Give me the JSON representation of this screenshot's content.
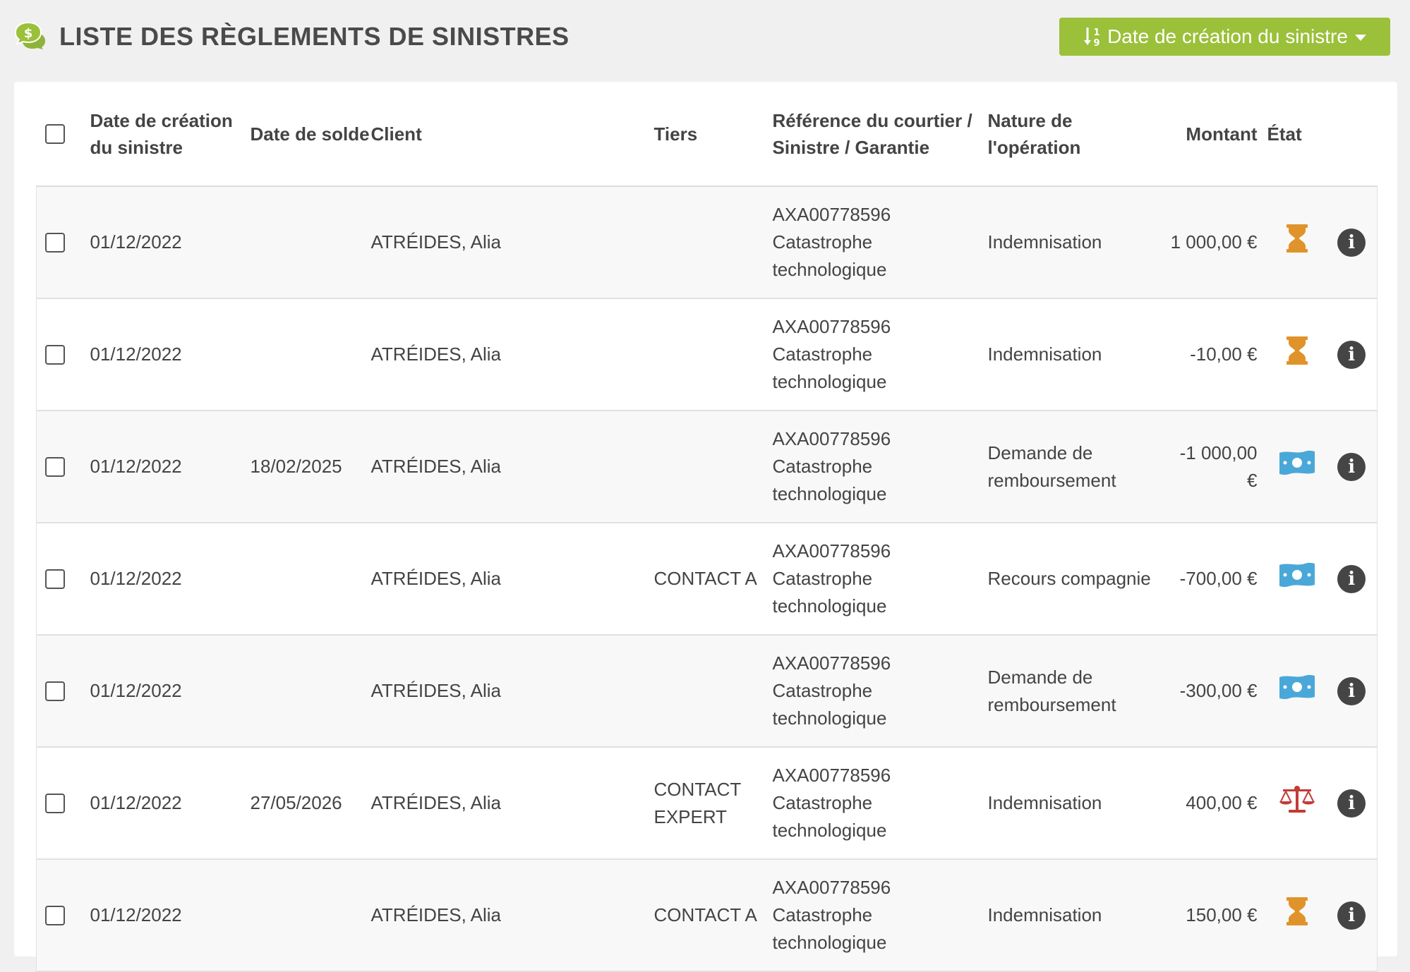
{
  "header": {
    "title": "LISTE DES RÈGLEMENTS DE SINISTRES",
    "title_icon": "money-chat-icon",
    "sort_button_label": "Date de création du sinistre",
    "accent_color": "#9bc03a"
  },
  "table": {
    "columns": {
      "creation_date": "Date de création du sinistre",
      "solde_date": "Date de solde",
      "client": "Client",
      "tiers": "Tiers",
      "reference": "Référence du courtier / Sinistre / Garantie",
      "nature": "Nature de l'opération",
      "amount": "Montant",
      "state": "État"
    },
    "rows": [
      {
        "creation_date": "01/12/2022",
        "solde_date": "",
        "client": "ATRÉIDES, Alia",
        "tiers": "",
        "ref": "AXA00778596",
        "guarantee": "Catastrophe technologique",
        "nature": "Indemnisation",
        "amount": "1 000,00 €",
        "state_icon": "hourglass-icon"
      },
      {
        "creation_date": "01/12/2022",
        "solde_date": "",
        "client": "ATRÉIDES, Alia",
        "tiers": "",
        "ref": "AXA00778596",
        "guarantee": "Catastrophe technologique",
        "nature": "Indemnisation",
        "amount": "-10,00 €",
        "state_icon": "hourglass-icon"
      },
      {
        "creation_date": "01/12/2022",
        "solde_date": "18/02/2025",
        "client": "ATRÉIDES, Alia",
        "tiers": "",
        "ref": "AXA00778596",
        "guarantee": "Catastrophe technologique",
        "nature": "Demande de remboursement",
        "amount": "-1 000,00 €",
        "state_icon": "money-bill-icon"
      },
      {
        "creation_date": "01/12/2022",
        "solde_date": "",
        "client": "ATRÉIDES, Alia",
        "tiers": "CONTACT A",
        "ref": "AXA00778596",
        "guarantee": "Catastrophe technologique",
        "nature": "Recours compagnie",
        "amount": "-700,00 €",
        "state_icon": "money-bill-icon"
      },
      {
        "creation_date": "01/12/2022",
        "solde_date": "",
        "client": "ATRÉIDES, Alia",
        "tiers": "",
        "ref": "AXA00778596",
        "guarantee": "Catastrophe technologique",
        "nature": "Demande de remboursement",
        "amount": "-300,00 €",
        "state_icon": "money-bill-icon"
      },
      {
        "creation_date": "01/12/2022",
        "solde_date": "27/05/2026",
        "client": "ATRÉIDES, Alia",
        "tiers": "CONTACT EXPERT",
        "ref": "AXA00778596",
        "guarantee": "Catastrophe technologique",
        "nature": "Indemnisation",
        "amount": "400,00 €",
        "state_icon": "balance-scale-icon"
      },
      {
        "creation_date": "01/12/2022",
        "solde_date": "",
        "client": "ATRÉIDES, Alia",
        "tiers": "CONTACT A",
        "ref": "AXA00778596",
        "guarantee": "Catastrophe technologique",
        "nature": "Indemnisation",
        "amount": "150,00 €",
        "state_icon": "hourglass-icon"
      }
    ],
    "info_glyph": "i",
    "colors": {
      "hourglass": "#e0932a",
      "money_bill": "#4aa8d8",
      "balance_scale": "#c23b36"
    }
  }
}
